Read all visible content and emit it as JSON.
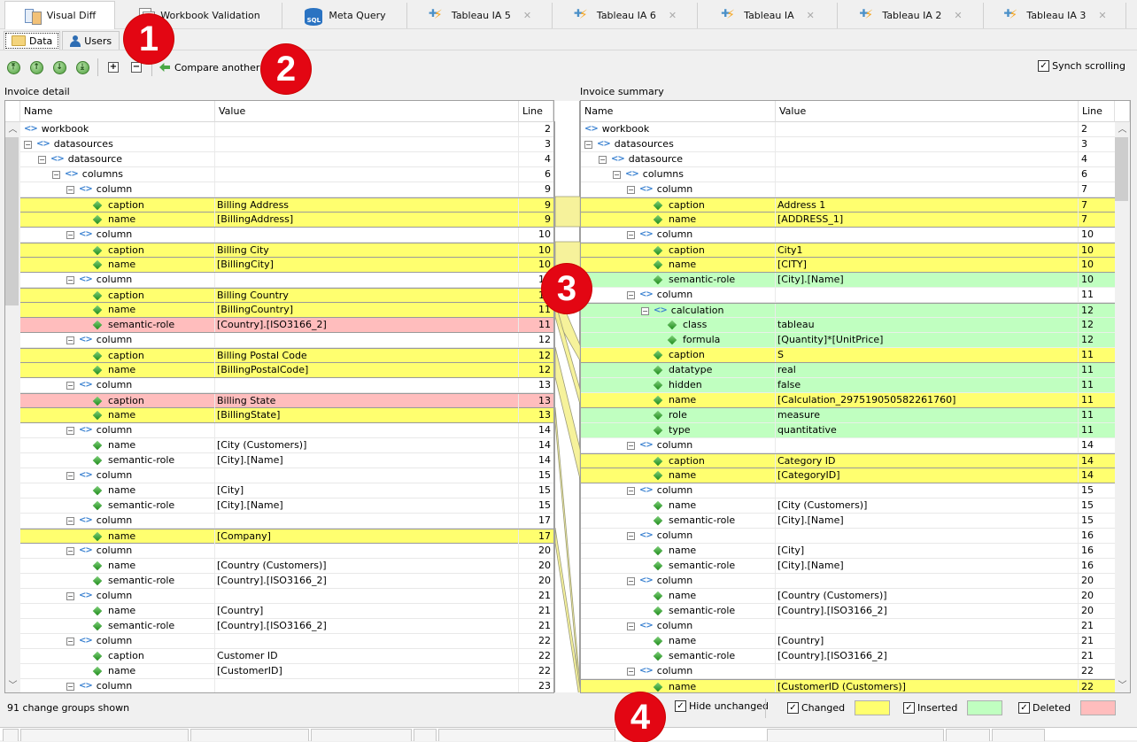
{
  "tabs": [
    {
      "label": "Visual Diff",
      "icon": "visual-diff-icon",
      "active": true,
      "closable": false
    },
    {
      "label": "Workbook Validation",
      "icon": "pages-icon",
      "active": false,
      "closable": false
    },
    {
      "label": "Meta Query",
      "icon": "sql-database-icon",
      "active": false,
      "closable": false
    },
    {
      "label": "Tableau IA 5",
      "icon": "tableau-icon",
      "active": false,
      "closable": true
    },
    {
      "label": "Tableau IA 6",
      "icon": "tableau-icon",
      "active": false,
      "closable": true
    },
    {
      "label": "Tableau IA",
      "icon": "tableau-icon",
      "active": false,
      "closable": true
    },
    {
      "label": "Tableau IA 2",
      "icon": "tableau-icon",
      "active": false,
      "closable": true
    },
    {
      "label": "Tableau IA 3",
      "icon": "tableau-icon",
      "active": false,
      "closable": true
    }
  ],
  "close_glyph": "✕",
  "subtabs": [
    {
      "label": "Data",
      "icon": "folder-icon",
      "active": true
    },
    {
      "label": "Users",
      "icon": "user-icon",
      "active": false
    }
  ],
  "toolbar": {
    "nav_buttons": [
      {
        "name": "first-change",
        "glyph": "⤒"
      },
      {
        "name": "previous-change",
        "glyph": "↑"
      },
      {
        "name": "next-change",
        "glyph": "↓"
      },
      {
        "name": "last-change",
        "glyph": "⤓"
      }
    ],
    "expand_glyph": "+",
    "collapse_glyph": "−",
    "compare_label": "Compare another",
    "synch_label": "Synch scrolling",
    "synch_checked": true
  },
  "columns": {
    "name": "Name",
    "value": "Value",
    "line": "Line"
  },
  "left": {
    "title": "Invoice detail",
    "rows": [
      {
        "level": 0,
        "type": "elem",
        "expander": false,
        "name": "workbook",
        "value": "",
        "line": "2",
        "status": ""
      },
      {
        "level": 0,
        "type": "elem",
        "expander": true,
        "name": "datasources",
        "value": "",
        "line": "3",
        "status": ""
      },
      {
        "level": 1,
        "type": "elem",
        "expander": true,
        "name": "datasource",
        "value": "",
        "line": "4",
        "status": ""
      },
      {
        "level": 2,
        "type": "elem",
        "expander": true,
        "name": "columns",
        "value": "",
        "line": "6",
        "status": ""
      },
      {
        "level": 3,
        "type": "elem",
        "expander": true,
        "name": "column",
        "value": "",
        "line": "9",
        "status": ""
      },
      {
        "level": 4,
        "type": "attr",
        "name": "caption",
        "value": "Billing Address",
        "line": "9",
        "status": "changed"
      },
      {
        "level": 4,
        "type": "attr",
        "name": "name",
        "value": "[BillingAddress]",
        "line": "9",
        "status": "changed"
      },
      {
        "level": 3,
        "type": "elem",
        "expander": true,
        "name": "column",
        "value": "",
        "line": "10",
        "status": ""
      },
      {
        "level": 4,
        "type": "attr",
        "name": "caption",
        "value": "Billing City",
        "line": "10",
        "status": "changed"
      },
      {
        "level": 4,
        "type": "attr",
        "name": "name",
        "value": "[BillingCity]",
        "line": "10",
        "status": "changed"
      },
      {
        "level": 3,
        "type": "elem",
        "expander": true,
        "name": "column",
        "value": "",
        "line": "11",
        "status": ""
      },
      {
        "level": 4,
        "type": "attr",
        "name": "caption",
        "value": "Billing Country",
        "line": "11",
        "status": "changed"
      },
      {
        "level": 4,
        "type": "attr",
        "name": "name",
        "value": "[BillingCountry]",
        "line": "11",
        "status": "changed"
      },
      {
        "level": 4,
        "type": "attr",
        "name": "semantic-role",
        "value": "[Country].[ISO3166_2]",
        "line": "11",
        "status": "deleted"
      },
      {
        "level": 3,
        "type": "elem",
        "expander": true,
        "name": "column",
        "value": "",
        "line": "12",
        "status": ""
      },
      {
        "level": 4,
        "type": "attr",
        "name": "caption",
        "value": "Billing Postal Code",
        "line": "12",
        "status": "changed"
      },
      {
        "level": 4,
        "type": "attr",
        "name": "name",
        "value": "[BillingPostalCode]",
        "line": "12",
        "status": "changed"
      },
      {
        "level": 3,
        "type": "elem",
        "expander": true,
        "name": "column",
        "value": "",
        "line": "13",
        "status": ""
      },
      {
        "level": 4,
        "type": "attr",
        "name": "caption",
        "value": "Billing State",
        "line": "13",
        "status": "deleted"
      },
      {
        "level": 4,
        "type": "attr",
        "name": "name",
        "value": "[BillingState]",
        "line": "13",
        "status": "changed"
      },
      {
        "level": 3,
        "type": "elem",
        "expander": true,
        "name": "column",
        "value": "",
        "line": "14",
        "status": ""
      },
      {
        "level": 4,
        "type": "attr",
        "name": "name",
        "value": "[City (Customers)]",
        "line": "14",
        "status": ""
      },
      {
        "level": 4,
        "type": "attr",
        "name": "semantic-role",
        "value": "[City].[Name]",
        "line": "14",
        "status": ""
      },
      {
        "level": 3,
        "type": "elem",
        "expander": true,
        "name": "column",
        "value": "",
        "line": "15",
        "status": ""
      },
      {
        "level": 4,
        "type": "attr",
        "name": "name",
        "value": "[City]",
        "line": "15",
        "status": ""
      },
      {
        "level": 4,
        "type": "attr",
        "name": "semantic-role",
        "value": "[City].[Name]",
        "line": "15",
        "status": ""
      },
      {
        "level": 3,
        "type": "elem",
        "expander": true,
        "name": "column",
        "value": "",
        "line": "17",
        "status": ""
      },
      {
        "level": 4,
        "type": "attr",
        "name": "name",
        "value": "[Company]",
        "line": "17",
        "status": "changed"
      },
      {
        "level": 3,
        "type": "elem",
        "expander": true,
        "name": "column",
        "value": "",
        "line": "20",
        "status": ""
      },
      {
        "level": 4,
        "type": "attr",
        "name": "name",
        "value": "[Country (Customers)]",
        "line": "20",
        "status": ""
      },
      {
        "level": 4,
        "type": "attr",
        "name": "semantic-role",
        "value": "[Country].[ISO3166_2]",
        "line": "20",
        "status": ""
      },
      {
        "level": 3,
        "type": "elem",
        "expander": true,
        "name": "column",
        "value": "",
        "line": "21",
        "status": ""
      },
      {
        "level": 4,
        "type": "attr",
        "name": "name",
        "value": "[Country]",
        "line": "21",
        "status": ""
      },
      {
        "level": 4,
        "type": "attr",
        "name": "semantic-role",
        "value": "[Country].[ISO3166_2]",
        "line": "21",
        "status": ""
      },
      {
        "level": 3,
        "type": "elem",
        "expander": true,
        "name": "column",
        "value": "",
        "line": "22",
        "status": ""
      },
      {
        "level": 4,
        "type": "attr",
        "name": "caption",
        "value": "Customer ID",
        "line": "22",
        "status": ""
      },
      {
        "level": 4,
        "type": "attr",
        "name": "name",
        "value": "[CustomerID]",
        "line": "22",
        "status": ""
      },
      {
        "level": 3,
        "type": "elem",
        "expander": true,
        "name": "column",
        "value": "",
        "line": "23",
        "status": ""
      }
    ]
  },
  "right": {
    "title": "Invoice summary",
    "rows": [
      {
        "level": 0,
        "type": "elem",
        "expander": false,
        "name": "workbook",
        "value": "",
        "line": "2",
        "status": ""
      },
      {
        "level": 0,
        "type": "elem",
        "expander": true,
        "name": "datasources",
        "value": "",
        "line": "3",
        "status": ""
      },
      {
        "level": 1,
        "type": "elem",
        "expander": true,
        "name": "datasource",
        "value": "",
        "line": "4",
        "status": ""
      },
      {
        "level": 2,
        "type": "elem",
        "expander": true,
        "name": "columns",
        "value": "",
        "line": "6",
        "status": ""
      },
      {
        "level": 3,
        "type": "elem",
        "expander": true,
        "name": "column",
        "value": "",
        "line": "7",
        "status": ""
      },
      {
        "level": 4,
        "type": "attr",
        "name": "caption",
        "value": "Address 1",
        "line": "7",
        "status": "changed"
      },
      {
        "level": 4,
        "type": "attr",
        "name": "name",
        "value": "[ADDRESS_1]",
        "line": "7",
        "status": "changed"
      },
      {
        "level": 3,
        "type": "elem",
        "expander": true,
        "name": "column",
        "value": "",
        "line": "10",
        "status": ""
      },
      {
        "level": 4,
        "type": "attr",
        "name": "caption",
        "value": "City1",
        "line": "10",
        "status": "changed"
      },
      {
        "level": 4,
        "type": "attr",
        "name": "name",
        "value": "[CITY]",
        "line": "10",
        "status": "changed"
      },
      {
        "level": 4,
        "type": "attr",
        "name": "semantic-role",
        "value": "[City].[Name]",
        "line": "10",
        "status": "inserted"
      },
      {
        "level": 3,
        "type": "elem",
        "expander": true,
        "name": "column",
        "value": "",
        "line": "11",
        "status": ""
      },
      {
        "level": 4,
        "type": "elem",
        "expander": true,
        "name": "calculation",
        "value": "",
        "line": "12",
        "status": "inserted"
      },
      {
        "level": 5,
        "type": "attr",
        "name": "class",
        "value": "tableau",
        "line": "12",
        "status": "inserted"
      },
      {
        "level": 5,
        "type": "attr",
        "name": "formula",
        "value": "[Quantity]*[UnitPrice]",
        "line": "12",
        "status": "inserted"
      },
      {
        "level": 4,
        "type": "attr",
        "name": "caption",
        "value": "S",
        "line": "11",
        "status": "changed"
      },
      {
        "level": 4,
        "type": "attr",
        "name": "datatype",
        "value": "real",
        "line": "11",
        "status": "inserted"
      },
      {
        "level": 4,
        "type": "attr",
        "name": "hidden",
        "value": "false",
        "line": "11",
        "status": "inserted"
      },
      {
        "level": 4,
        "type": "attr",
        "name": "name",
        "value": "[Calculation_297519050582261760]",
        "line": "11",
        "status": "changed"
      },
      {
        "level": 4,
        "type": "attr",
        "name": "role",
        "value": "measure",
        "line": "11",
        "status": "inserted"
      },
      {
        "level": 4,
        "type": "attr",
        "name": "type",
        "value": "quantitative",
        "line": "11",
        "status": "inserted"
      },
      {
        "level": 3,
        "type": "elem",
        "expander": true,
        "name": "column",
        "value": "",
        "line": "14",
        "status": ""
      },
      {
        "level": 4,
        "type": "attr",
        "name": "caption",
        "value": "Category ID",
        "line": "14",
        "status": "changed"
      },
      {
        "level": 4,
        "type": "attr",
        "name": "name",
        "value": "[CategoryID]",
        "line": "14",
        "status": "changed"
      },
      {
        "level": 3,
        "type": "elem",
        "expander": true,
        "name": "column",
        "value": "",
        "line": "15",
        "status": ""
      },
      {
        "level": 4,
        "type": "attr",
        "name": "name",
        "value": "[City (Customers)]",
        "line": "15",
        "status": ""
      },
      {
        "level": 4,
        "type": "attr",
        "name": "semantic-role",
        "value": "[City].[Name]",
        "line": "15",
        "status": ""
      },
      {
        "level": 3,
        "type": "elem",
        "expander": true,
        "name": "column",
        "value": "",
        "line": "16",
        "status": ""
      },
      {
        "level": 4,
        "type": "attr",
        "name": "name",
        "value": "[City]",
        "line": "16",
        "status": ""
      },
      {
        "level": 4,
        "type": "attr",
        "name": "semantic-role",
        "value": "[City].[Name]",
        "line": "16",
        "status": ""
      },
      {
        "level": 3,
        "type": "elem",
        "expander": true,
        "name": "column",
        "value": "",
        "line": "20",
        "status": ""
      },
      {
        "level": 4,
        "type": "attr",
        "name": "name",
        "value": "[Country (Customers)]",
        "line": "20",
        "status": ""
      },
      {
        "level": 4,
        "type": "attr",
        "name": "semantic-role",
        "value": "[Country].[ISO3166_2]",
        "line": "20",
        "status": ""
      },
      {
        "level": 3,
        "type": "elem",
        "expander": true,
        "name": "column",
        "value": "",
        "line": "21",
        "status": ""
      },
      {
        "level": 4,
        "type": "attr",
        "name": "name",
        "value": "[Country]",
        "line": "21",
        "status": ""
      },
      {
        "level": 4,
        "type": "attr",
        "name": "semantic-role",
        "value": "[Country].[ISO3166_2]",
        "line": "21",
        "status": ""
      },
      {
        "level": 3,
        "type": "elem",
        "expander": true,
        "name": "column",
        "value": "",
        "line": "22",
        "status": ""
      },
      {
        "level": 4,
        "type": "attr",
        "name": "name",
        "value": "[CustomerID (Customers)]",
        "line": "22",
        "status": "changed"
      }
    ]
  },
  "links": [
    {
      "left": [
        5,
        6
      ],
      "right": [
        5,
        6
      ]
    },
    {
      "left": [
        8,
        9
      ],
      "right": [
        8,
        9
      ]
    },
    {
      "left": [
        11,
        12
      ],
      "right": [
        15,
        15
      ]
    },
    {
      "left": [
        12,
        12
      ],
      "right": [
        18,
        18
      ]
    },
    {
      "left": [
        15,
        16
      ],
      "right": [
        22,
        23
      ]
    },
    {
      "left": [
        19,
        19
      ],
      "right": [
        38,
        38
      ]
    },
    {
      "left": [
        27,
        27
      ],
      "right": [
        38,
        38
      ]
    }
  ],
  "status": {
    "count_text": "91 change groups shown",
    "hide_unchanged_label": "Hide unchanged",
    "hide_unchanged_checked": true,
    "legend": [
      {
        "label": "Changed",
        "checked": true,
        "color": "#ffff6f"
      },
      {
        "label": "Inserted",
        "checked": true,
        "color": "#c0ffc0"
      },
      {
        "label": "Deleted",
        "checked": true,
        "color": "#ffbdbd"
      }
    ]
  },
  "colors": {
    "changed": "#ffff6f",
    "inserted": "#c0ffc0",
    "deleted": "#ffbdbd",
    "link_fill": "#f5f08a",
    "link_stroke": "#9a9a7a",
    "badge": "#e30613"
  },
  "annotations": [
    "1",
    "2",
    "3",
    "4"
  ],
  "check_glyph": "✓"
}
